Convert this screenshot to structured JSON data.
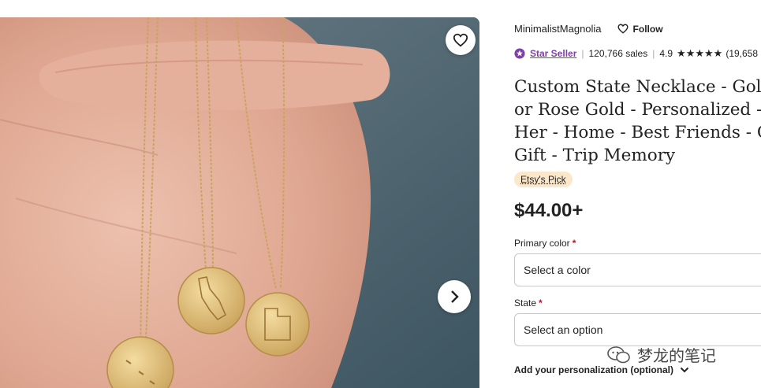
{
  "shop": {
    "name": "MinimalistMagnolia",
    "follow_label": "Follow"
  },
  "seller": {
    "badge_label": "Star Seller",
    "sales": "120,766 sales",
    "rating": "4.9",
    "reviews": "(19,658"
  },
  "product": {
    "title_lines": [
      "Custom State Necklace - Gold, S",
      "or Rose Gold - Personalized - Gi",
      "Her - Home - Best Friends - Grad",
      "Gift - Trip Memory"
    ],
    "pick_label": "Etsy's Pick",
    "price": "$44.00+"
  },
  "options": {
    "primary_color_label": "Primary color",
    "primary_color_value": "Select a color",
    "state_label": "State",
    "state_value": "Select an option",
    "required_mark": "*"
  },
  "personalization": {
    "label": "Add your personalization (optional)"
  },
  "watermark": {
    "text": "梦龙的笔记"
  },
  "colors": {
    "star_seller": "#7e3fa6",
    "pick_bg": "#fbe7c9",
    "required": "#a61a2e"
  },
  "icons": {
    "favorite": "heart-outline-icon",
    "next": "chevron-right-icon",
    "follow": "heart-outline-icon",
    "star_seller": "star-badge-icon",
    "personalization": "chevron-down-icon"
  }
}
